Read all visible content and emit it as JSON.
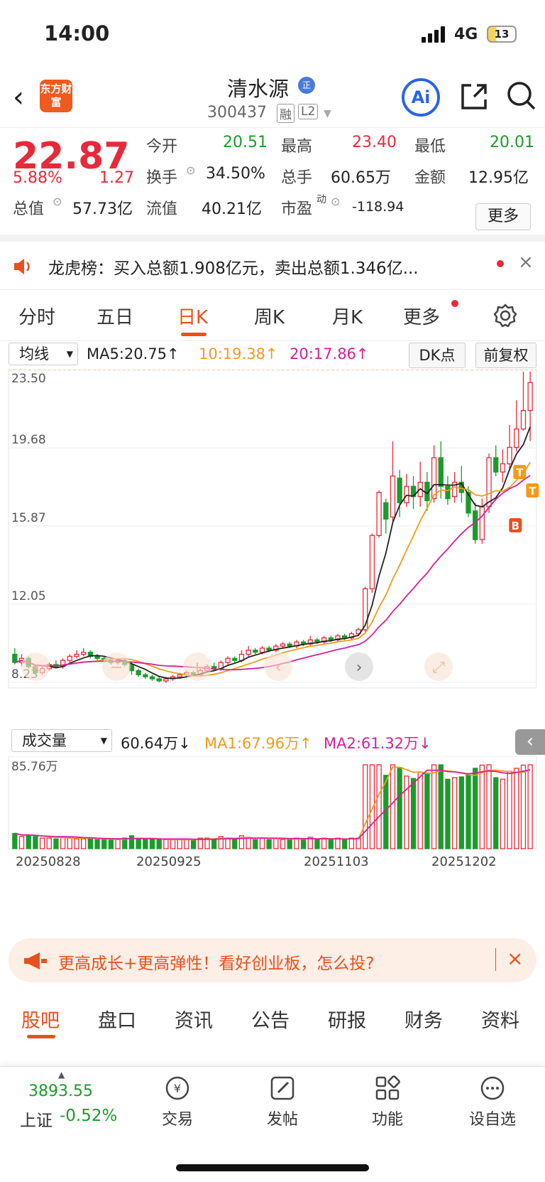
{
  "status": {
    "time": "14:00",
    "network": "4G",
    "battery": "13"
  },
  "nav": {
    "logo": "东方财富",
    "title": "清水源",
    "title_tag": "正",
    "code": "300437",
    "badges": [
      "融",
      "L2"
    ],
    "ai_label": "Ai"
  },
  "quote": {
    "price": "22.87",
    "change_pct": "5.88%",
    "change": "1.27",
    "rows": [
      [
        {
          "label": "今开",
          "value": "20.51",
          "color": "green"
        },
        {
          "label": "最高",
          "value": "23.40",
          "color": "red"
        },
        {
          "label": "最低",
          "value": "20.01",
          "color": "green"
        }
      ],
      [
        {
          "label": "换手",
          "value": "34.50%"
        },
        {
          "label": "总手",
          "value": "60.65万"
        },
        {
          "label": "金额",
          "value": "12.95亿"
        }
      ],
      [
        {
          "label": "总值",
          "value": "57.73亿"
        },
        {
          "label": "流值",
          "value": "40.21亿"
        },
        {
          "label": "市盈",
          "sup": "动",
          "value": "-118.94"
        }
      ]
    ],
    "more": "更多"
  },
  "notice": {
    "text": "龙虎榜：买入总额1.908亿元，卖出总额1.346亿..."
  },
  "chart_tabs": [
    "分时",
    "五日",
    "日K",
    "周K",
    "月K",
    "更多"
  ],
  "ma_row": {
    "selector": "均线",
    "ma5": "MA5:20.75↑",
    "ma10": "10:19.38↑",
    "ma20": "20:17.86↑",
    "dk": "DK点",
    "adjust": "前复权"
  },
  "vol_row": {
    "selector": "成交量",
    "vol": "60.64万↓",
    "ma1": "MA1:67.96万↑",
    "ma2": "MA2:61.32万↓"
  },
  "chart_data": [
    {
      "type": "candlestick",
      "y_ticks": [
        "23.50",
        "19.68",
        "15.87",
        "12.05",
        "8.23"
      ],
      "ylim": [
        8.23,
        23.5
      ],
      "candles": [
        [
          9.6,
          9.2,
          9.9,
          9.1
        ],
        [
          9.2,
          9.4,
          9.6,
          9.0
        ],
        [
          9.4,
          9.0,
          9.5,
          8.9
        ],
        [
          9.0,
          8.7,
          9.1,
          8.6
        ],
        [
          8.7,
          8.9,
          9.0,
          8.6
        ],
        [
          8.9,
          9.1,
          9.2,
          8.8
        ],
        [
          9.1,
          9.0,
          9.3,
          8.9
        ],
        [
          9.0,
          9.3,
          9.4,
          8.9
        ],
        [
          9.3,
          9.5,
          9.6,
          9.2
        ],
        [
          9.5,
          9.6,
          9.8,
          9.4
        ],
        [
          9.6,
          9.7,
          9.9,
          9.5
        ],
        [
          9.7,
          9.5,
          9.8,
          9.4
        ],
        [
          9.5,
          9.4,
          9.6,
          9.3
        ],
        [
          9.4,
          9.3,
          9.5,
          9.2
        ],
        [
          9.3,
          9.2,
          9.4,
          9.1
        ],
        [
          9.2,
          9.3,
          9.4,
          9.1
        ],
        [
          9.3,
          9.1,
          9.4,
          9.0
        ],
        [
          9.1,
          8.8,
          9.2,
          8.6
        ],
        [
          8.8,
          8.6,
          8.9,
          8.5
        ],
        [
          8.6,
          8.5,
          8.7,
          8.4
        ],
        [
          8.5,
          8.4,
          8.6,
          8.3
        ],
        [
          8.4,
          8.3,
          8.5,
          8.23
        ],
        [
          8.3,
          8.4,
          8.5,
          8.2
        ],
        [
          8.4,
          8.5,
          8.6,
          8.3
        ],
        [
          8.5,
          8.6,
          8.7,
          8.4
        ],
        [
          8.6,
          8.7,
          8.8,
          8.5
        ],
        [
          8.7,
          8.6,
          8.8,
          8.5
        ],
        [
          8.6,
          8.8,
          8.9,
          8.5
        ],
        [
          8.8,
          9.0,
          9.1,
          8.7
        ],
        [
          9.0,
          8.9,
          9.2,
          8.8
        ],
        [
          8.9,
          9.2,
          9.3,
          8.8
        ],
        [
          9.2,
          9.4,
          9.5,
          9.1
        ],
        [
          9.4,
          9.3,
          9.5,
          9.2
        ],
        [
          9.3,
          9.6,
          9.8,
          9.2
        ],
        [
          9.6,
          9.8,
          10.0,
          9.5
        ],
        [
          9.8,
          9.7,
          9.9,
          9.6
        ],
        [
          9.7,
          9.9,
          10.0,
          9.6
        ],
        [
          9.9,
          9.8,
          10.0,
          9.7
        ],
        [
          9.8,
          10.0,
          10.1,
          9.7
        ],
        [
          10.0,
          10.1,
          10.2,
          9.9
        ],
        [
          10.1,
          10.0,
          10.2,
          9.9
        ],
        [
          10.0,
          10.2,
          10.3,
          9.9
        ],
        [
          10.2,
          10.1,
          10.3,
          10.0
        ],
        [
          10.1,
          10.3,
          10.5,
          10.0
        ],
        [
          10.3,
          10.2,
          10.4,
          10.1
        ],
        [
          10.2,
          10.4,
          10.5,
          10.1
        ],
        [
          10.4,
          10.3,
          10.5,
          10.2
        ],
        [
          10.3,
          10.5,
          10.6,
          10.2
        ],
        [
          10.5,
          10.4,
          10.6,
          10.3
        ],
        [
          10.4,
          10.6,
          10.7,
          10.3
        ],
        [
          10.6,
          10.8,
          10.9,
          10.5
        ],
        [
          10.8,
          12.8,
          12.9,
          10.7
        ],
        [
          12.8,
          15.4,
          15.5,
          12.6
        ],
        [
          15.4,
          17.5,
          17.6,
          15.3
        ],
        [
          17.0,
          16.2,
          17.2,
          15.5
        ],
        [
          16.3,
          18.3,
          20.0,
          16.0
        ],
        [
          18.2,
          17.0,
          18.6,
          16.3
        ],
        [
          17.0,
          17.8,
          18.4,
          16.8
        ],
        [
          17.8,
          17.3,
          18.3,
          16.7
        ],
        [
          17.3,
          18.0,
          19.0,
          16.8
        ],
        [
          18.0,
          17.1,
          18.5,
          16.6
        ],
        [
          17.2,
          19.2,
          19.8,
          17.0
        ],
        [
          19.2,
          17.8,
          20.0,
          17.2
        ],
        [
          17.8,
          17.2,
          18.3,
          16.9
        ],
        [
          17.3,
          18.0,
          18.5,
          17.0
        ],
        [
          18.0,
          17.5,
          18.8,
          17.0
        ],
        [
          17.5,
          16.5,
          17.8,
          16.3
        ],
        [
          16.6,
          15.2,
          17.0,
          15.0
        ],
        [
          15.2,
          16.8,
          17.2,
          15.0
        ],
        [
          16.8,
          19.2,
          19.4,
          16.5
        ],
        [
          19.2,
          18.5,
          19.8,
          18.3
        ],
        [
          18.5,
          18.9,
          19.6,
          18.0
        ],
        [
          18.9,
          19.7,
          20.8,
          18.6
        ],
        [
          19.7,
          20.6,
          22.0,
          19.5
        ],
        [
          20.6,
          21.5,
          23.4,
          20.5
        ],
        [
          21.5,
          22.87,
          23.4,
          20.01
        ]
      ],
      "signals": [
        "T",
        "T",
        "B"
      ]
    },
    {
      "type": "bar",
      "y_ticks": [
        "85.76万"
      ],
      "x_ticks": [
        "20250828",
        "20250925",
        "20251103",
        "20251202"
      ],
      "ylim": [
        0,
        85.76
      ]
    }
  ],
  "banner": {
    "text": "更高成长+更高弹性！看好创业板，怎么投?"
  },
  "bottom_tabs": [
    "股吧",
    "盘口",
    "资讯",
    "公告",
    "研报",
    "财务",
    "资料"
  ],
  "footer": {
    "index_value": "3893.55",
    "index_name": "上证",
    "index_change": "-0.52%",
    "items": [
      "交易",
      "发帖",
      "功能",
      "设自选"
    ]
  }
}
